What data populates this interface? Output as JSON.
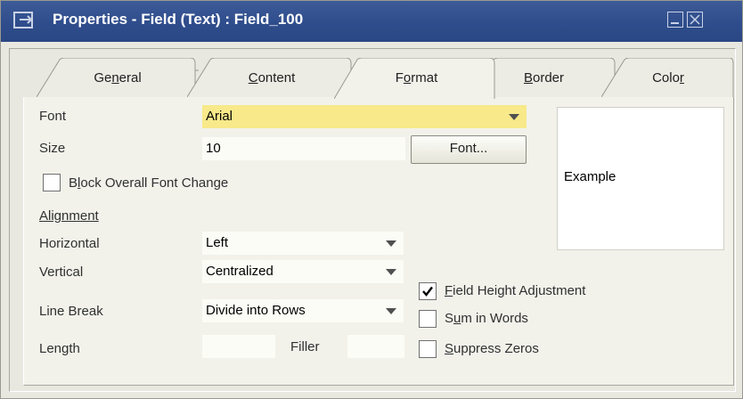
{
  "window": {
    "title": "Properties - Field (Text) : Field_100",
    "icon": "properties-window-icon"
  },
  "tabs": [
    {
      "label": "General",
      "key": "n",
      "active": false
    },
    {
      "label": "Content",
      "key": "C",
      "active": false
    },
    {
      "label": "Format",
      "key": "o",
      "active": true
    },
    {
      "label": "Border",
      "key": "B",
      "active": false
    },
    {
      "label": "Color",
      "key": "r",
      "active": false
    }
  ],
  "format": {
    "font_label": "Font",
    "font_value": "Arial",
    "size_label": "Size",
    "size_value": "10",
    "font_button": "Font...",
    "block_font_change": {
      "label": "Block Overall Font Change",
      "checked": false
    },
    "example_text": "Example",
    "alignment_header": "Alignment",
    "horizontal_label": "Horizontal",
    "horizontal_value": "Left",
    "vertical_label": "Vertical",
    "vertical_value": "Centralized",
    "line_break_label": "Line Break",
    "line_break_value": "Divide into Rows",
    "length_label": "Length",
    "length_value": "",
    "filler_label": "Filler",
    "filler_value": "",
    "field_height_adjustment": {
      "label": "Field Height Adjustment",
      "checked": true
    },
    "sum_in_words": {
      "label": "Sum in Words",
      "checked": false
    },
    "suppress_zeros": {
      "label": "Suppress Zeros",
      "checked": false
    }
  },
  "colors": {
    "titlebar": "#2f4d8c",
    "font_field_highlight": "#f8e98a",
    "panel": "#f2f2eb"
  }
}
